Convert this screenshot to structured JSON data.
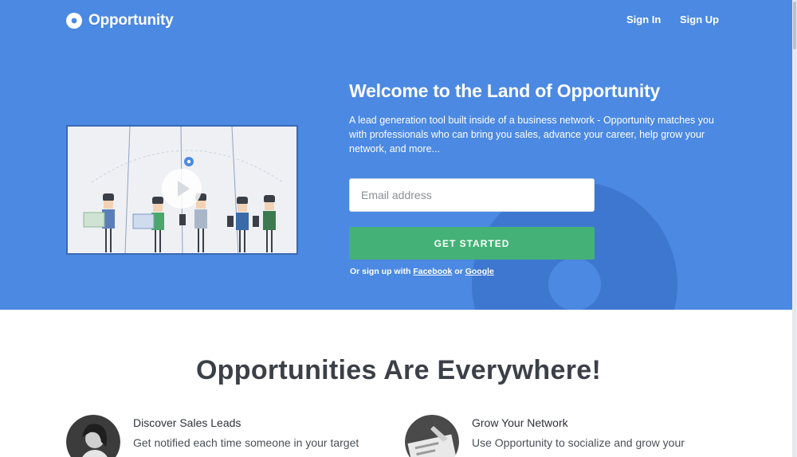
{
  "header": {
    "brand": "Opportunity",
    "nav": [
      {
        "label": "Sign In"
      },
      {
        "label": "Sign Up"
      }
    ]
  },
  "hero": {
    "title": "Welcome to the Land of Opportunity",
    "description": "A lead generation tool built inside of a business network - Opportunity matches you with professionals who can bring you sales, advance your career, help grow your network, and more...",
    "email_placeholder": "Email address",
    "cta_label": "GET STARTED",
    "alt_prefix": "Or sign up with",
    "alt_facebook": "Facebook",
    "alt_or": "or",
    "alt_google": "Google"
  },
  "features": {
    "title": "Opportunities Are Everywhere!",
    "items": [
      {
        "title": "Discover Sales Leads",
        "description": "Get notified each time someone in your target"
      },
      {
        "title": "Grow Your Network",
        "description": "Use Opportunity to socialize and grow your"
      }
    ]
  },
  "colors": {
    "hero_bg": "#4b89e2",
    "cta_bg": "#44b276",
    "deco": "#3e77cf"
  }
}
